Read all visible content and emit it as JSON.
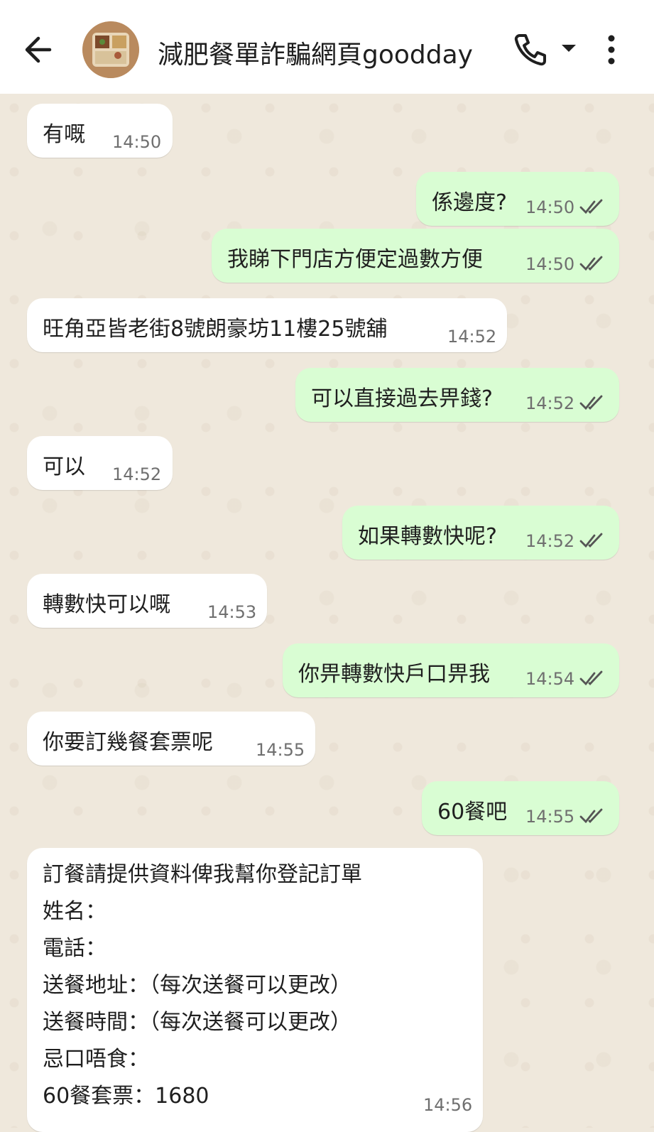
{
  "header": {
    "contact_name": "減肥餐單詐騙網頁goodday",
    "back_icon": "back-arrow-icon",
    "call_icon": "phone-icon",
    "dropdown_icon": "caret-down-icon",
    "menu_icon": "more-vert-icon"
  },
  "messages": [
    {
      "dir": "in",
      "text": "有嘅",
      "time": "14:50"
    },
    {
      "dir": "out",
      "text": "係邊度?",
      "time": "14:50"
    },
    {
      "dir": "out",
      "text": "我睇下門店方便定過數方便",
      "time": "14:50"
    },
    {
      "dir": "in",
      "text": "旺角亞皆老街8號朗豪坊11樓25號舖",
      "time": "14:52"
    },
    {
      "dir": "out",
      "text": "可以直接過去畀錢?",
      "time": "14:52"
    },
    {
      "dir": "in",
      "text": "可以",
      "time": "14:52"
    },
    {
      "dir": "out",
      "text": "如果轉數快呢?",
      "time": "14:52"
    },
    {
      "dir": "in",
      "text": "轉數快可以嘅",
      "time": "14:53"
    },
    {
      "dir": "out",
      "text": "你畀轉數快戶口畀我",
      "time": "14:54"
    },
    {
      "dir": "in",
      "text": "你要訂幾餐套票呢",
      "time": "14:55"
    },
    {
      "dir": "out",
      "text": "60餐吧",
      "time": "14:55"
    },
    {
      "dir": "in",
      "text": "訂餐請提供資料俾我幫你登記訂單\n姓名：\n電話：\n送餐地址：（每次送餐可以更改）\n送餐時間：（每次送餐可以更改）\n忌口唔食：\n60餐套票：1680",
      "time": "14:56"
    }
  ],
  "colors": {
    "incoming_bubble": "#ffffff",
    "outgoing_bubble": "#d9fdd3",
    "wallpaper": "#efe8dc"
  }
}
